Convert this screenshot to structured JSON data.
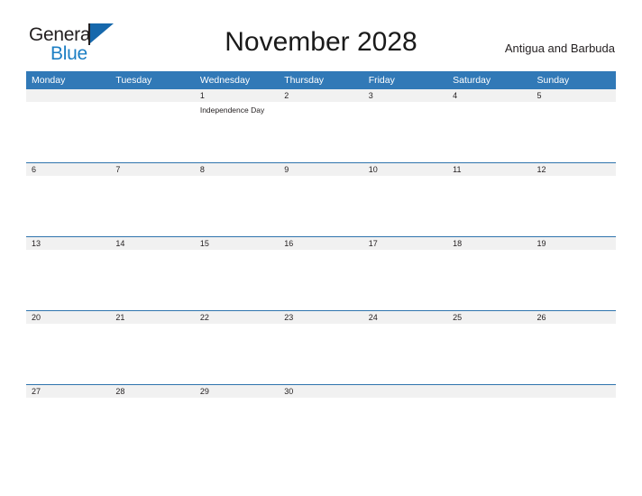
{
  "brand": {
    "name_top": "General",
    "name_bottom": "Blue",
    "accent_color": "#1c7fc4",
    "flag_color": "#1668ac"
  },
  "header": {
    "title": "November 2028",
    "region": "Antigua and Barbuda"
  },
  "calendar": {
    "header_bg": "#3179b7",
    "header_text_color": "#ffffff",
    "band_bg": "#f1f1f1",
    "rule_color": "#2f74ad",
    "weekdays": [
      "Monday",
      "Tuesday",
      "Wednesday",
      "Thursday",
      "Friday",
      "Saturday",
      "Sunday"
    ],
    "weeks": [
      [
        {
          "day": "",
          "events": []
        },
        {
          "day": "",
          "events": []
        },
        {
          "day": "1",
          "events": [
            "Independence Day"
          ]
        },
        {
          "day": "2",
          "events": []
        },
        {
          "day": "3",
          "events": []
        },
        {
          "day": "4",
          "events": []
        },
        {
          "day": "5",
          "events": []
        }
      ],
      [
        {
          "day": "6",
          "events": []
        },
        {
          "day": "7",
          "events": []
        },
        {
          "day": "8",
          "events": []
        },
        {
          "day": "9",
          "events": []
        },
        {
          "day": "10",
          "events": []
        },
        {
          "day": "11",
          "events": []
        },
        {
          "day": "12",
          "events": []
        }
      ],
      [
        {
          "day": "13",
          "events": []
        },
        {
          "day": "14",
          "events": []
        },
        {
          "day": "15",
          "events": []
        },
        {
          "day": "16",
          "events": []
        },
        {
          "day": "17",
          "events": []
        },
        {
          "day": "18",
          "events": []
        },
        {
          "day": "19",
          "events": []
        }
      ],
      [
        {
          "day": "20",
          "events": []
        },
        {
          "day": "21",
          "events": []
        },
        {
          "day": "22",
          "events": []
        },
        {
          "day": "23",
          "events": []
        },
        {
          "day": "24",
          "events": []
        },
        {
          "day": "25",
          "events": []
        },
        {
          "day": "26",
          "events": []
        }
      ],
      [
        {
          "day": "27",
          "events": []
        },
        {
          "day": "28",
          "events": []
        },
        {
          "day": "29",
          "events": []
        },
        {
          "day": "30",
          "events": []
        },
        {
          "day": "",
          "events": []
        },
        {
          "day": "",
          "events": []
        },
        {
          "day": "",
          "events": []
        }
      ]
    ]
  }
}
